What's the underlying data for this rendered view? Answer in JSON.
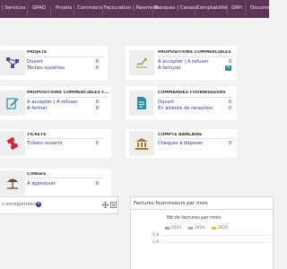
{
  "nav": {
    "items": [
      {
        "key": "accueil",
        "label": "| Services"
      },
      {
        "key": "gpao",
        "label": "GPAO"
      },
      {
        "key": "projets",
        "label": "Projets"
      },
      {
        "key": "commerce",
        "label": "Commerce"
      },
      {
        "key": "facturation",
        "label": "Facturation | Paiement"
      },
      {
        "key": "banques",
        "label": "Banques | Caisses"
      },
      {
        "key": "comptabilite",
        "label": "Comptabilité"
      },
      {
        "key": "grh",
        "label": "GRH"
      },
      {
        "key": "documents",
        "label": "Documen"
      }
    ]
  },
  "boxes": {
    "projets": {
      "icon": "project-icon",
      "title": "PROJETS",
      "rows": [
        {
          "label": "Ouvert",
          "count": "0"
        },
        {
          "label": "Tâches ouvertes",
          "count": "0"
        }
      ]
    },
    "propositions_commerciales": {
      "icon": "signature-icon",
      "title": "PROPOSITIONS COMMERCIALES",
      "rows": [
        {
          "label": "A accepter | A refuser",
          "count": "0"
        },
        {
          "label": "A facturer",
          "count": "4"
        }
      ]
    },
    "propositions_fournisseurs": {
      "icon": "signature-icon",
      "title": "PROPOSITIONS COMMERCIALES FOURNISSEURS",
      "rows": [
        {
          "label": "A accepter | A refuser",
          "count": "0"
        },
        {
          "label": "A fermer",
          "count": "0"
        }
      ]
    },
    "commandes_fournisseurs": {
      "icon": "document-icon",
      "title": "COMMANDES FOURNISSEURS",
      "rows": [
        {
          "label": "Ouvert",
          "count": "0"
        },
        {
          "label": "En attente de réception",
          "count": "0"
        }
      ]
    },
    "tickets": {
      "icon": "ticket-icon",
      "title": "TICKETS",
      "rows": [
        {
          "label": "Tickets ouverts",
          "count": "0"
        }
      ]
    },
    "compte_bancaire": {
      "icon": "bank-icon",
      "title": "COMPTE BANCAIRE",
      "rows": [
        {
          "label": "Chèques à déposer",
          "count": "0"
        }
      ]
    },
    "conges": {
      "icon": "beach-icon",
      "title": "CONGÉS",
      "rows": [
        {
          "label": "A approuver",
          "count": "0"
        }
      ]
    }
  },
  "widget_left": {
    "text": "s enregistrées",
    "count": "0"
  },
  "widget_right": {
    "title": "Factures fournisseurs par mois",
    "chart_data": {
      "type": "bar",
      "title": "Nb de factures par mois",
      "series": [
        {
          "name": "2023",
          "color": "#b58ec9"
        },
        {
          "name": "2024",
          "color": "#8fb0e3"
        },
        {
          "name": "2025",
          "color": "#e6b94e"
        }
      ],
      "y_ticks": [
        "1.8",
        "1.6"
      ]
    }
  }
}
